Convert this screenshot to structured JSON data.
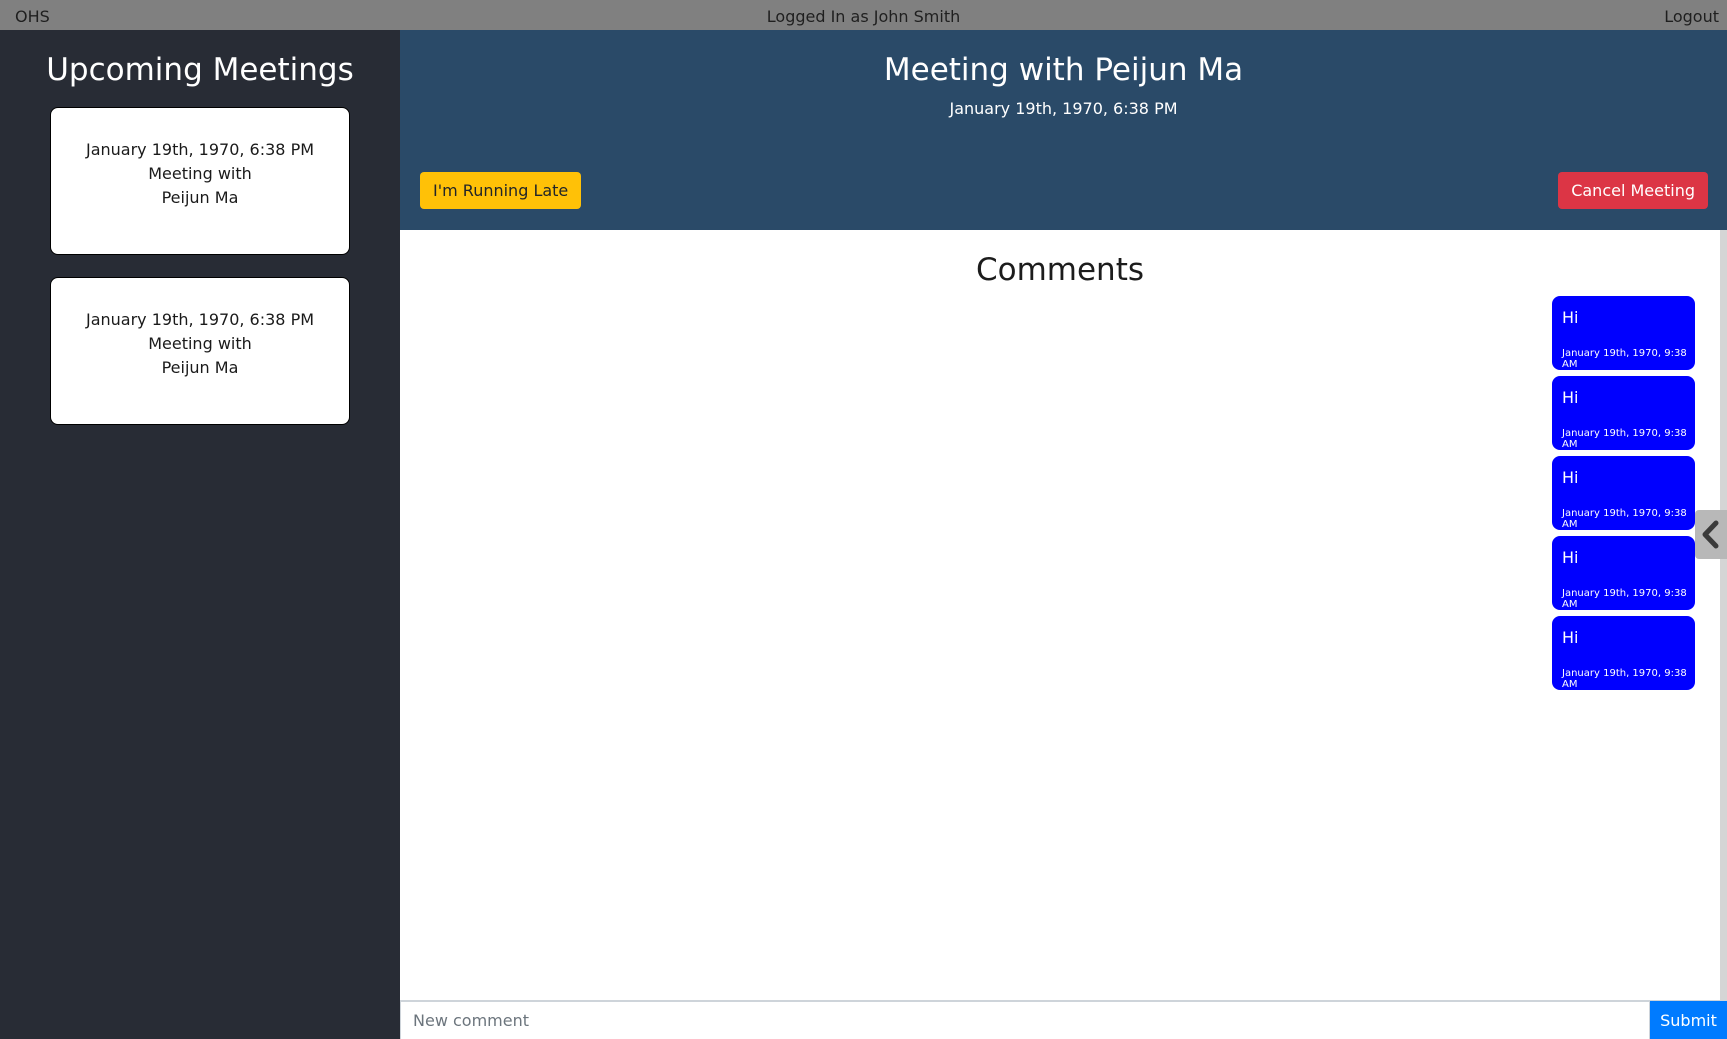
{
  "topbar": {
    "brand": "OHS",
    "logged_in": "Logged In as John Smith",
    "logout": "Logout"
  },
  "sidebar": {
    "title": "Upcoming Meetings",
    "meetings": [
      {
        "date": "January 19th, 1970, 6:38 PM",
        "line1": "Meeting with",
        "line2": "Peijun Ma"
      },
      {
        "date": "January 19th, 1970, 6:38 PM",
        "line1": "Meeting with",
        "line2": "Peijun Ma"
      }
    ]
  },
  "header": {
    "title": "Meeting with Peijun Ma",
    "date": "January 19th, 1970, 6:38 PM",
    "late_button": "I'm Running Late",
    "cancel_button": "Cancel Meeting"
  },
  "comments": {
    "title": "Comments",
    "items": [
      {
        "text": "Hi",
        "time": "January 19th, 1970, 9:38 AM"
      },
      {
        "text": "Hi",
        "time": "January 19th, 1970, 9:38 AM"
      },
      {
        "text": "Hi",
        "time": "January 19th, 1970, 9:38 AM"
      },
      {
        "text": "Hi",
        "time": "January 19th, 1970, 9:38 AM"
      },
      {
        "text": "Hi",
        "time": "January 19th, 1970, 9:38 AM"
      }
    ]
  },
  "form": {
    "placeholder": "New comment",
    "value": "",
    "submit": "Submit"
  },
  "icons": {
    "collapse": "chevron-left-icon"
  },
  "colors": {
    "sidebar_bg": "#282c35",
    "header_bg": "#2a4a68",
    "bubble_bg": "#0000ff",
    "late_button": "#ffc107",
    "cancel_button": "#dc3545",
    "submit_button": "#007bff"
  }
}
